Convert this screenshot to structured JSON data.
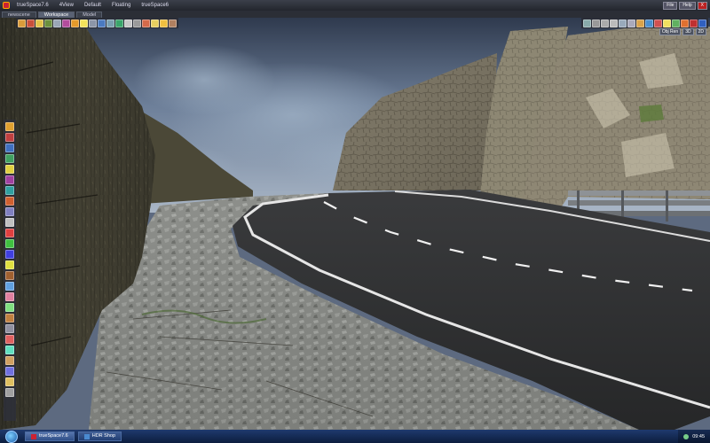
{
  "menubar": {
    "app_label": "trueSpace7.6",
    "items": [
      "4View",
      "Default",
      "Floating",
      "trueSpace6"
    ],
    "system_buttons": [
      "File",
      "Help",
      "X"
    ]
  },
  "tabs": [
    "newscene",
    "Workspace",
    "Model"
  ],
  "view_buttons": [
    "Obj Ren",
    "3D",
    "2D"
  ],
  "taskbar": {
    "tasks": [
      "trueSpace7.6",
      "HDR Shop"
    ],
    "clock": "09:45"
  },
  "colors": {
    "sky": "#3d4a60",
    "road": "#2e2f31",
    "road_line": "#e8e8e8",
    "rock": "#6e6a5e",
    "gravel": "#8a8c88",
    "taskbar": "#1a3466"
  }
}
